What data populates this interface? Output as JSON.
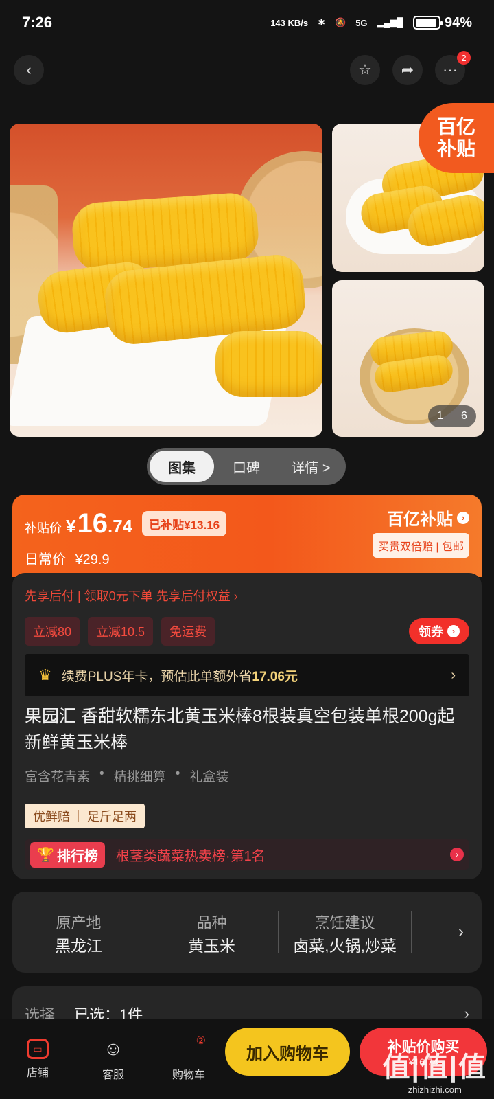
{
  "status_bar": {
    "time": "7:26",
    "speed": "143 KB/s",
    "network": "5G",
    "battery": "94%",
    "battery_level": 0.94
  },
  "nav": {
    "back_icon": "chevron-left-icon",
    "favorite_icon": "star-icon",
    "share_icon": "share-icon",
    "more_badge": "2"
  },
  "gallery": {
    "corner_badge_line1": "百亿",
    "corner_badge_line2": "补贴",
    "page_current": "1",
    "page_total": "6"
  },
  "tabs": [
    {
      "label": "图集"
    },
    {
      "label": "口碑"
    },
    {
      "label": "详情 >"
    }
  ],
  "price": {
    "label": "补贴价",
    "yen": "¥",
    "integer": "16",
    "decimal": ".74",
    "saved": "已补贴¥13.16",
    "regular_label": "日常价",
    "regular_price": "¥29.9",
    "brand": "百亿补贴",
    "brand_sub": "买贵双倍赔 | 包邮"
  },
  "info": {
    "credit_line": "先享后付 | 领取0元下单 先享后付权益 ›",
    "coupons": [
      "立减80",
      "立减10.5",
      "免运费"
    ],
    "get_coupon": "领券",
    "plus_text": "续费PLUS年卡，预估此单额外省",
    "plus_amount": "17.06元",
    "title": "果园汇 香甜软糯东北黄玉米棒8根装真空包装单根200g起新鲜黄玉米棒",
    "features": [
      "富含花青素",
      "精挑细算",
      "礼盒装"
    ],
    "guarantees": [
      "优鲜赔",
      "足斤足两"
    ],
    "rank_badge": "排行榜",
    "rank_text": "根茎类蔬菜热卖榜·第1名"
  },
  "attributes": [
    {
      "key": "原产地",
      "value": "黑龙江"
    },
    {
      "key": "品种",
      "value": "黄玉米"
    },
    {
      "key": "烹饪建议",
      "value": "卤菜,火锅,炒菜"
    }
  ],
  "select": {
    "label": "选择",
    "value": "已选：1件"
  },
  "bottom_bar": {
    "shop": "店铺",
    "service": "客服",
    "cart": "购物车",
    "cart_count": "②",
    "add_to_cart": "加入购物车",
    "buy_line1": "补贴价购买",
    "buy_line2": "¥16.74"
  },
  "watermark": {
    "big": "值|值|值",
    "small": "zhizhizhi.com"
  }
}
